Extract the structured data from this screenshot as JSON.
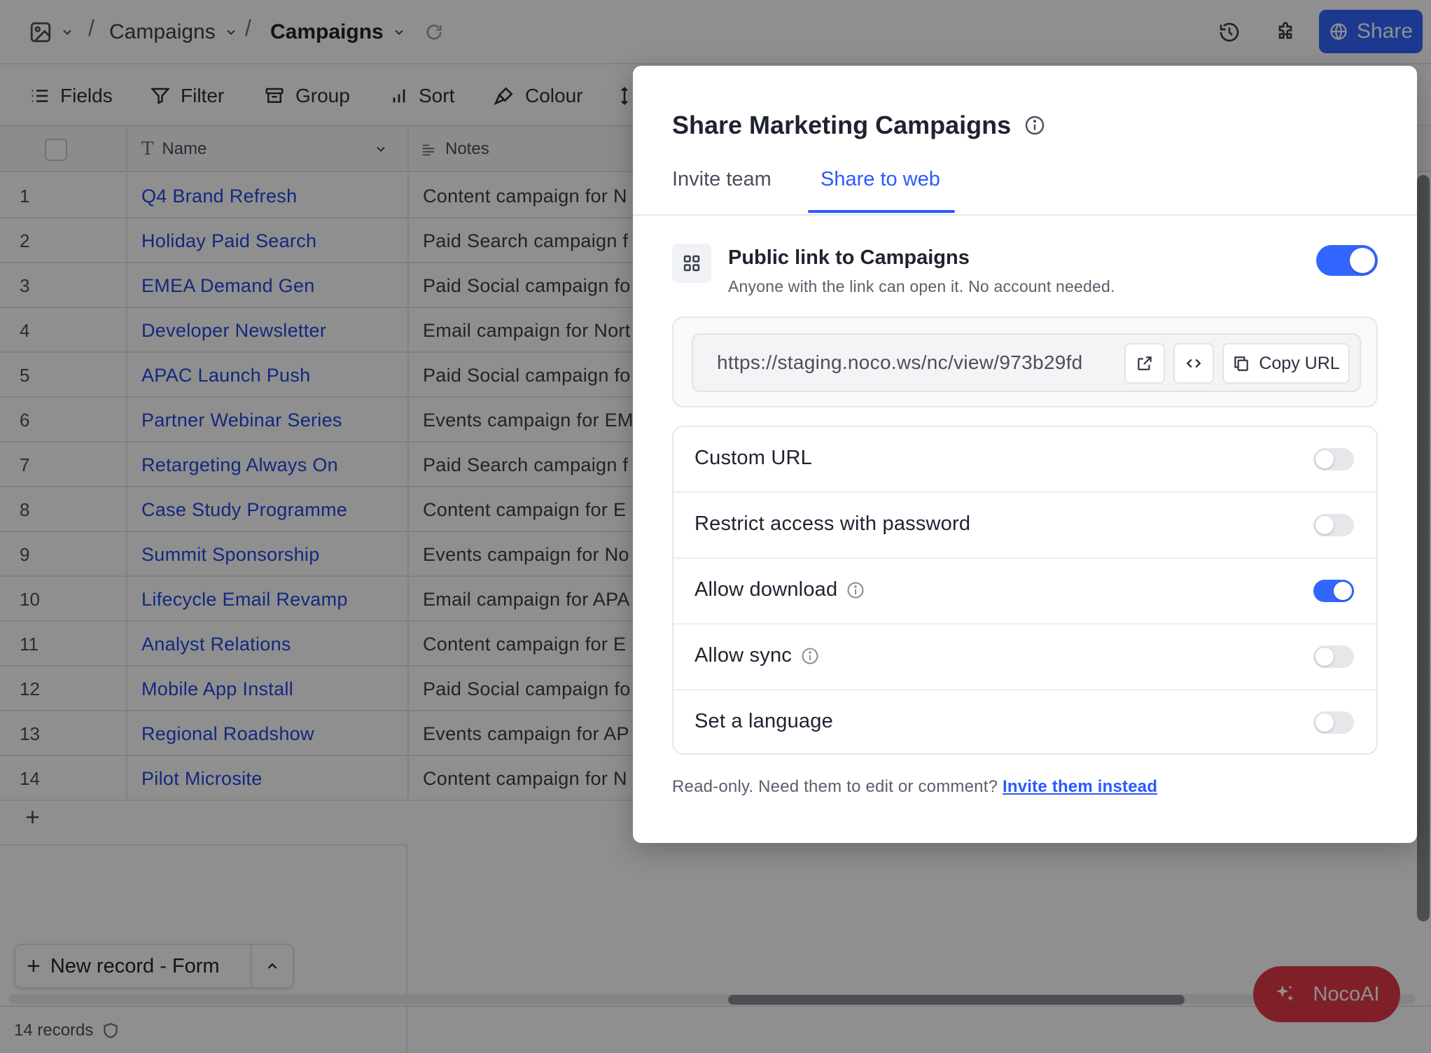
{
  "topbar": {
    "breadcrumb_base": "Campaigns",
    "breadcrumb_view": "Campaigns",
    "share_label": "Share"
  },
  "toolbar": {
    "fields": "Fields",
    "filter": "Filter",
    "group": "Group",
    "sort": "Sort",
    "colour": "Colour"
  },
  "grid": {
    "columns": {
      "name": "Name",
      "notes": "Notes"
    },
    "rows": [
      {
        "n": "1",
        "name": "Q4 Brand Refresh",
        "notes": "Content campaign for N"
      },
      {
        "n": "2",
        "name": "Holiday Paid Search",
        "notes": "Paid Search campaign f"
      },
      {
        "n": "3",
        "name": "EMEA Demand Gen",
        "notes": "Paid Social campaign fo"
      },
      {
        "n": "4",
        "name": "Developer Newsletter",
        "notes": "Email campaign for Nort"
      },
      {
        "n": "5",
        "name": "APAC Launch Push",
        "notes": "Paid Social campaign fo"
      },
      {
        "n": "6",
        "name": "Partner Webinar Series",
        "notes": "Events campaign for EM"
      },
      {
        "n": "7",
        "name": "Retargeting Always On",
        "notes": "Paid Search campaign f"
      },
      {
        "n": "8",
        "name": "Case Study Programme",
        "notes": "Content campaign for E"
      },
      {
        "n": "9",
        "name": "Summit Sponsorship",
        "notes": "Events campaign for No"
      },
      {
        "n": "10",
        "name": "Lifecycle Email Revamp",
        "notes": "Email campaign for APA"
      },
      {
        "n": "11",
        "name": "Analyst Relations",
        "notes": "Content campaign for E"
      },
      {
        "n": "12",
        "name": "Mobile App Install",
        "notes": "Paid Social campaign fo"
      },
      {
        "n": "13",
        "name": "Regional Roadshow",
        "notes": "Events campaign for AP"
      },
      {
        "n": "14",
        "name": "Pilot Microsite",
        "notes": "Content campaign for N"
      }
    ],
    "new_record_label": "New record - Form",
    "records_count": "14 records"
  },
  "nocoai_label": "NocoAI",
  "modal": {
    "title": "Share Marketing Campaigns",
    "tabs": [
      "Invite team",
      "Share to web"
    ],
    "active_tab": "Share to web",
    "public_link": {
      "title": "Public link to Campaigns",
      "subtitle": "Anyone with the link can open it. No account needed.",
      "enabled": true
    },
    "url": "https://staging.noco.ws/nc/view/973b29fd",
    "copy_label": "Copy URL",
    "options": [
      {
        "label": "Custom URL",
        "info": false,
        "enabled": false
      },
      {
        "label": "Restrict access with password",
        "info": false,
        "enabled": false
      },
      {
        "label": "Allow download",
        "info": true,
        "enabled": true
      },
      {
        "label": "Allow sync",
        "info": true,
        "enabled": false
      },
      {
        "label": "Set a language",
        "info": false,
        "enabled": false
      }
    ],
    "footer_text": "Read-only. Need them to edit or comment?",
    "footer_link": "Invite them instead"
  },
  "colors": {
    "accent": "#3366ff",
    "link": "#2348e0",
    "nocoai": "#e33a4a"
  }
}
